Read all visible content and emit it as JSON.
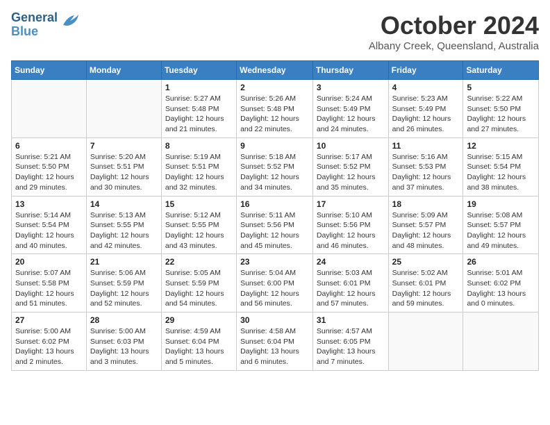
{
  "header": {
    "logo_line1": "General",
    "logo_line2": "Blue",
    "month": "October 2024",
    "location": "Albany Creek, Queensland, Australia"
  },
  "weekdays": [
    "Sunday",
    "Monday",
    "Tuesday",
    "Wednesday",
    "Thursday",
    "Friday",
    "Saturday"
  ],
  "weeks": [
    [
      {
        "day": "",
        "sunrise": "",
        "sunset": "",
        "daylight": ""
      },
      {
        "day": "",
        "sunrise": "",
        "sunset": "",
        "daylight": ""
      },
      {
        "day": "1",
        "sunrise": "Sunrise: 5:27 AM",
        "sunset": "Sunset: 5:48 PM",
        "daylight": "Daylight: 12 hours and 21 minutes."
      },
      {
        "day": "2",
        "sunrise": "Sunrise: 5:26 AM",
        "sunset": "Sunset: 5:48 PM",
        "daylight": "Daylight: 12 hours and 22 minutes."
      },
      {
        "day": "3",
        "sunrise": "Sunrise: 5:24 AM",
        "sunset": "Sunset: 5:49 PM",
        "daylight": "Daylight: 12 hours and 24 minutes."
      },
      {
        "day": "4",
        "sunrise": "Sunrise: 5:23 AM",
        "sunset": "Sunset: 5:49 PM",
        "daylight": "Daylight: 12 hours and 26 minutes."
      },
      {
        "day": "5",
        "sunrise": "Sunrise: 5:22 AM",
        "sunset": "Sunset: 5:50 PM",
        "daylight": "Daylight: 12 hours and 27 minutes."
      }
    ],
    [
      {
        "day": "6",
        "sunrise": "Sunrise: 5:21 AM",
        "sunset": "Sunset: 5:50 PM",
        "daylight": "Daylight: 12 hours and 29 minutes."
      },
      {
        "day": "7",
        "sunrise": "Sunrise: 5:20 AM",
        "sunset": "Sunset: 5:51 PM",
        "daylight": "Daylight: 12 hours and 30 minutes."
      },
      {
        "day": "8",
        "sunrise": "Sunrise: 5:19 AM",
        "sunset": "Sunset: 5:51 PM",
        "daylight": "Daylight: 12 hours and 32 minutes."
      },
      {
        "day": "9",
        "sunrise": "Sunrise: 5:18 AM",
        "sunset": "Sunset: 5:52 PM",
        "daylight": "Daylight: 12 hours and 34 minutes."
      },
      {
        "day": "10",
        "sunrise": "Sunrise: 5:17 AM",
        "sunset": "Sunset: 5:52 PM",
        "daylight": "Daylight: 12 hours and 35 minutes."
      },
      {
        "day": "11",
        "sunrise": "Sunrise: 5:16 AM",
        "sunset": "Sunset: 5:53 PM",
        "daylight": "Daylight: 12 hours and 37 minutes."
      },
      {
        "day": "12",
        "sunrise": "Sunrise: 5:15 AM",
        "sunset": "Sunset: 5:54 PM",
        "daylight": "Daylight: 12 hours and 38 minutes."
      }
    ],
    [
      {
        "day": "13",
        "sunrise": "Sunrise: 5:14 AM",
        "sunset": "Sunset: 5:54 PM",
        "daylight": "Daylight: 12 hours and 40 minutes."
      },
      {
        "day": "14",
        "sunrise": "Sunrise: 5:13 AM",
        "sunset": "Sunset: 5:55 PM",
        "daylight": "Daylight: 12 hours and 42 minutes."
      },
      {
        "day": "15",
        "sunrise": "Sunrise: 5:12 AM",
        "sunset": "Sunset: 5:55 PM",
        "daylight": "Daylight: 12 hours and 43 minutes."
      },
      {
        "day": "16",
        "sunrise": "Sunrise: 5:11 AM",
        "sunset": "Sunset: 5:56 PM",
        "daylight": "Daylight: 12 hours and 45 minutes."
      },
      {
        "day": "17",
        "sunrise": "Sunrise: 5:10 AM",
        "sunset": "Sunset: 5:56 PM",
        "daylight": "Daylight: 12 hours and 46 minutes."
      },
      {
        "day": "18",
        "sunrise": "Sunrise: 5:09 AM",
        "sunset": "Sunset: 5:57 PM",
        "daylight": "Daylight: 12 hours and 48 minutes."
      },
      {
        "day": "19",
        "sunrise": "Sunrise: 5:08 AM",
        "sunset": "Sunset: 5:57 PM",
        "daylight": "Daylight: 12 hours and 49 minutes."
      }
    ],
    [
      {
        "day": "20",
        "sunrise": "Sunrise: 5:07 AM",
        "sunset": "Sunset: 5:58 PM",
        "daylight": "Daylight: 12 hours and 51 minutes."
      },
      {
        "day": "21",
        "sunrise": "Sunrise: 5:06 AM",
        "sunset": "Sunset: 5:59 PM",
        "daylight": "Daylight: 12 hours and 52 minutes."
      },
      {
        "day": "22",
        "sunrise": "Sunrise: 5:05 AM",
        "sunset": "Sunset: 5:59 PM",
        "daylight": "Daylight: 12 hours and 54 minutes."
      },
      {
        "day": "23",
        "sunrise": "Sunrise: 5:04 AM",
        "sunset": "Sunset: 6:00 PM",
        "daylight": "Daylight: 12 hours and 56 minutes."
      },
      {
        "day": "24",
        "sunrise": "Sunrise: 5:03 AM",
        "sunset": "Sunset: 6:01 PM",
        "daylight": "Daylight: 12 hours and 57 minutes."
      },
      {
        "day": "25",
        "sunrise": "Sunrise: 5:02 AM",
        "sunset": "Sunset: 6:01 PM",
        "daylight": "Daylight: 12 hours and 59 minutes."
      },
      {
        "day": "26",
        "sunrise": "Sunrise: 5:01 AM",
        "sunset": "Sunset: 6:02 PM",
        "daylight": "Daylight: 13 hours and 0 minutes."
      }
    ],
    [
      {
        "day": "27",
        "sunrise": "Sunrise: 5:00 AM",
        "sunset": "Sunset: 6:02 PM",
        "daylight": "Daylight: 13 hours and 2 minutes."
      },
      {
        "day": "28",
        "sunrise": "Sunrise: 5:00 AM",
        "sunset": "Sunset: 6:03 PM",
        "daylight": "Daylight: 13 hours and 3 minutes."
      },
      {
        "day": "29",
        "sunrise": "Sunrise: 4:59 AM",
        "sunset": "Sunset: 6:04 PM",
        "daylight": "Daylight: 13 hours and 5 minutes."
      },
      {
        "day": "30",
        "sunrise": "Sunrise: 4:58 AM",
        "sunset": "Sunset: 6:04 PM",
        "daylight": "Daylight: 13 hours and 6 minutes."
      },
      {
        "day": "31",
        "sunrise": "Sunrise: 4:57 AM",
        "sunset": "Sunset: 6:05 PM",
        "daylight": "Daylight: 13 hours and 7 minutes."
      },
      {
        "day": "",
        "sunrise": "",
        "sunset": "",
        "daylight": ""
      },
      {
        "day": "",
        "sunrise": "",
        "sunset": "",
        "daylight": ""
      }
    ]
  ]
}
